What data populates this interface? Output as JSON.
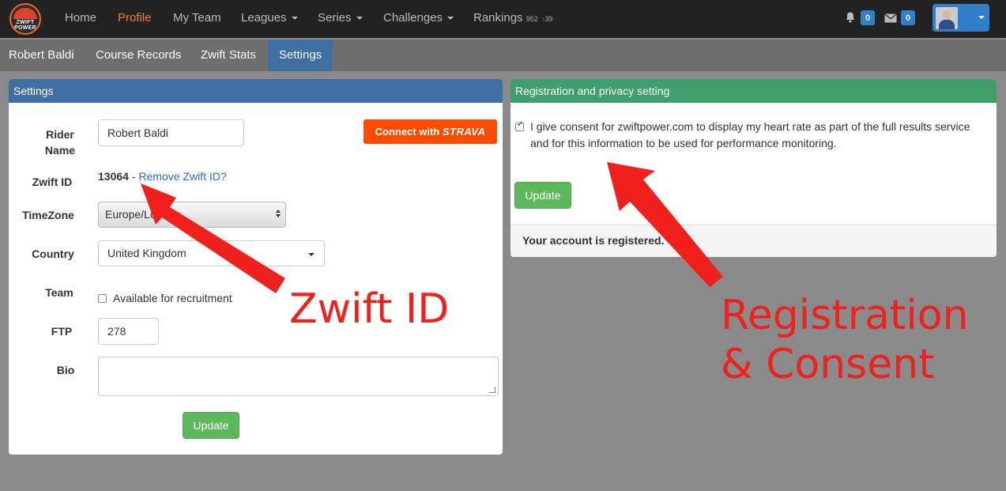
{
  "nav": {
    "logo": {
      "line1": "ZWIFT",
      "line2": "POWER"
    },
    "items": [
      {
        "label": "Home"
      },
      {
        "label": "Profile"
      },
      {
        "label": "My Team"
      },
      {
        "label": "Leagues"
      },
      {
        "label": "Series"
      },
      {
        "label": "Challenges"
      },
      {
        "label": "Rankings",
        "small": "952",
        "up": "39"
      }
    ],
    "notifications_count": "0",
    "messages_count": "0"
  },
  "subnav": {
    "items": [
      "Robert Baldi",
      "Course Records",
      "Zwift Stats",
      "Settings"
    ]
  },
  "settings": {
    "title": "Settings",
    "rider_name_label_1": "Rider",
    "rider_name_label_2": "Name",
    "rider_name_value": "Robert Baldi",
    "strava_prefix": "Connect with",
    "strava_brand": "STRAVA",
    "zwift_id_label": "Zwift ID",
    "zwift_id_value": "13064",
    "separator": "-",
    "remove_link": "Remove Zwift ID?",
    "timezone_label": "TimeZone",
    "timezone_value": "Europe/London",
    "country_label": "Country",
    "country_value": "United Kingdom",
    "team_label": "Team",
    "recruit_label": "Available for recruitment",
    "ftp_label": "FTP",
    "ftp_value": "278",
    "bio_label": "Bio",
    "update_label": "Update"
  },
  "privacy": {
    "title": "Registration and privacy setting",
    "consent_line1": "I give consent for zwiftpower.com to display my heart rate as part of the full results service",
    "consent_line2": "and for this information to be used for performance monitoring.",
    "update_label": "Update",
    "status": "Your account is registered."
  },
  "annotations": {
    "zwift_id": "Zwift ID",
    "registration_line1": "Registration",
    "registration_line2": "& Consent",
    "color": "#f0211c"
  },
  "colors": {
    "navbar": "#222222",
    "active_nav": "#f58025",
    "settings_header": "#3f6fa3",
    "privacy_header": "#3f9f6f",
    "button_green": "#5cb85c",
    "strava": "#fc4c02",
    "badge": "#2f80c8"
  }
}
